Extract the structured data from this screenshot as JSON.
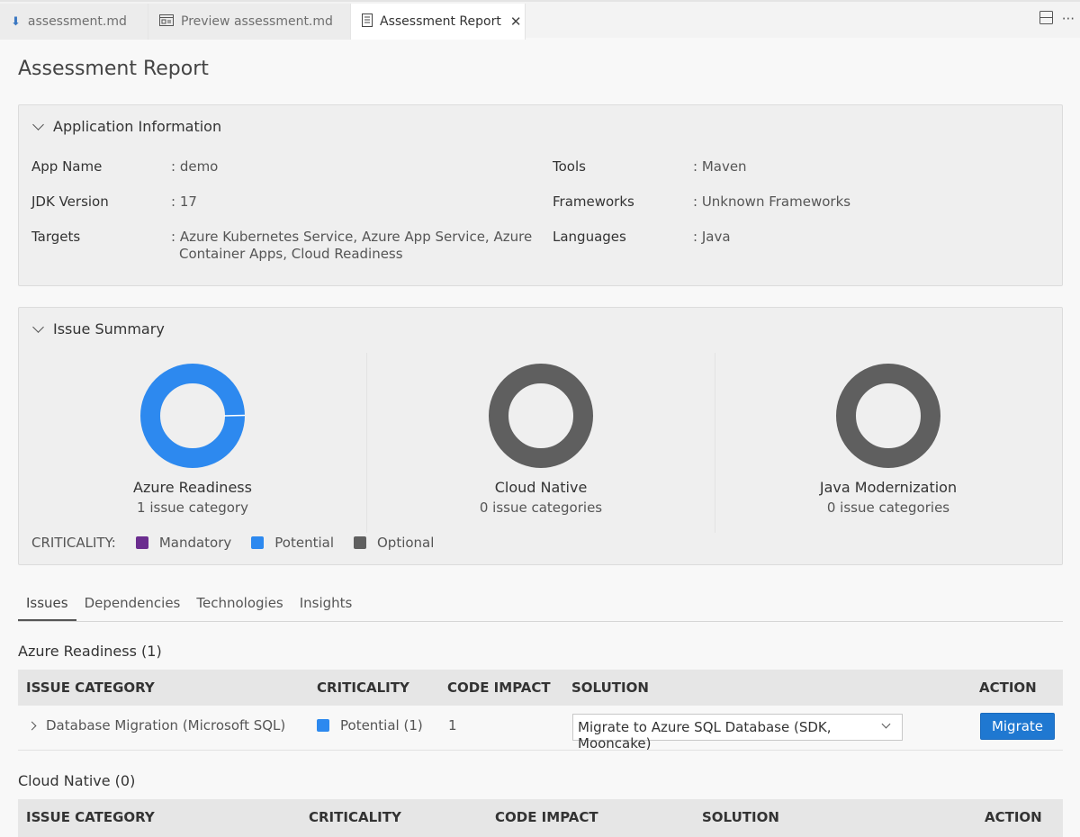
{
  "tabs": [
    {
      "label": "assessment.md",
      "icon": "download-icon"
    },
    {
      "label": "Preview assessment.md",
      "icon": "preview-icon"
    },
    {
      "label": "Assessment Report",
      "icon": "document-icon",
      "active": true
    }
  ],
  "page_title": "Assessment Report",
  "app_info": {
    "heading": "Application Information",
    "left": [
      {
        "label": "App Name",
        "value": ": demo"
      },
      {
        "label": "JDK Version",
        "value": ": 17"
      },
      {
        "label": "Targets",
        "value": ": Azure Kubernetes Service, Azure App Service, Azure",
        "value2": "Container Apps, Cloud Readiness"
      }
    ],
    "right": [
      {
        "label": "Tools",
        "value": ": Maven"
      },
      {
        "label": "Frameworks",
        "value": ": Unknown Frameworks"
      },
      {
        "label": "Languages",
        "value": ": Java"
      }
    ]
  },
  "issue_summary": {
    "heading": "Issue Summary",
    "donuts": [
      {
        "title": "Azure Readiness",
        "subtitle": "1 issue category",
        "color": "#2d89ef"
      },
      {
        "title": "Cloud Native",
        "subtitle": "0 issue categories",
        "color": "#5f5f5f"
      },
      {
        "title": "Java Modernization",
        "subtitle": "0 issue categories",
        "color": "#5f5f5f"
      }
    ],
    "legend": {
      "label": "CRITICALITY:",
      "items": [
        {
          "label": "Mandatory",
          "color": "#6b2d8f"
        },
        {
          "label": "Potential",
          "color": "#2d89ef"
        },
        {
          "label": "Optional",
          "color": "#5f5f5f"
        }
      ]
    }
  },
  "content_tabs": [
    "Issues",
    "Dependencies",
    "Technologies",
    "Insights"
  ],
  "sections": [
    {
      "title": "Azure Readiness (1)",
      "columns": [
        "ISSUE CATEGORY",
        "CRITICALITY",
        "CODE IMPACT",
        "SOLUTION",
        "ACTION"
      ],
      "rows": [
        {
          "category": "Database Migration (Microsoft SQL)",
          "criticality": "Potential (1)",
          "criticality_color": "#2d89ef",
          "impact": "1",
          "solution": "Migrate to Azure SQL Database (SDK, Mooncake)",
          "action": "Migrate"
        }
      ]
    },
    {
      "title": "Cloud Native (0)",
      "columns": [
        "ISSUE CATEGORY",
        "CRITICALITY",
        "CODE IMPACT",
        "SOLUTION",
        "ACTION"
      ]
    }
  ]
}
